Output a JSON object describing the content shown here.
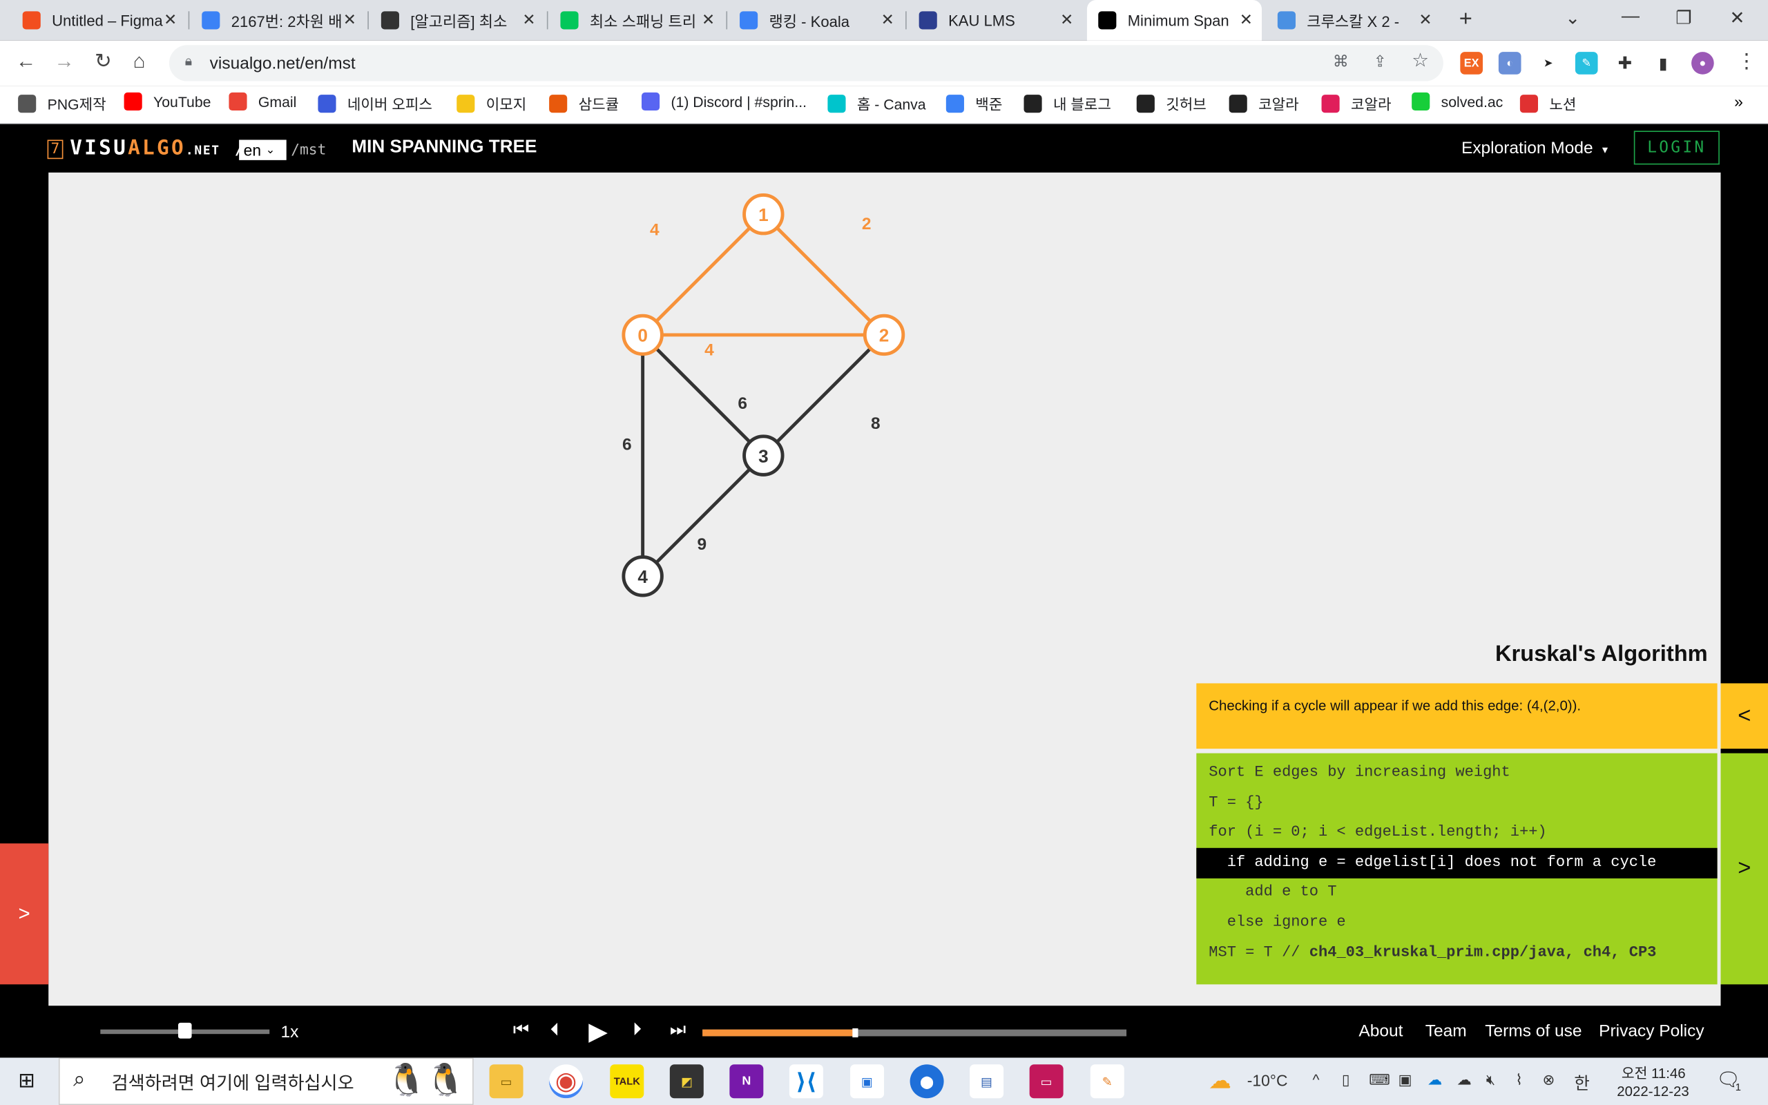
{
  "browser": {
    "tabs": [
      {
        "title": "Untitled – Figma",
        "icon": "figma-icon",
        "color": "#f24e1e"
      },
      {
        "title": "2167번: 2차원 배",
        "icon": "code-icon",
        "color": "#3b82f6"
      },
      {
        "title": "[알고리즘] 최소",
        "icon": "penguin-icon",
        "color": "#333333"
      },
      {
        "title": "최소 스패닝 트리",
        "icon": "blog-icon",
        "color": "#03c75a"
      },
      {
        "title": "랭킹 - Koala",
        "icon": "code-icon",
        "color": "#3b82f6"
      },
      {
        "title": "KAU LMS",
        "icon": "kau-icon",
        "color": "#2c3e8f"
      },
      {
        "title": "Minimum Span",
        "icon": "visualgo-icon",
        "color": "#000000"
      },
      {
        "title": "크루스칼 X 2 -",
        "icon": "layers-icon",
        "color": "#4a90e2"
      }
    ],
    "active_tab": 6,
    "url": "visualgo.net/en/mst",
    "bookmarks": [
      {
        "label": "PNG제작",
        "icon": "layers-icon",
        "color": "#555555"
      },
      {
        "label": "YouTube",
        "icon": "youtube-icon",
        "color": "#ff0000"
      },
      {
        "label": "Gmail",
        "icon": "gmail-icon",
        "color": "#ea4335"
      },
      {
        "label": "네이버 오피스",
        "icon": "grid-icon",
        "color": "#3b5bdb"
      },
      {
        "label": "이모지",
        "icon": "emoji-icon",
        "color": "#f5c518"
      },
      {
        "label": "삼드큘",
        "icon": "cube-icon",
        "color": "#e8590c"
      },
      {
        "label": "(1) Discord | #sprin...",
        "icon": "discord-icon",
        "color": "#5865f2"
      },
      {
        "label": "홈 - Canva",
        "icon": "canva-icon",
        "color": "#00c4cc"
      },
      {
        "label": "백준",
        "icon": "code-icon",
        "color": "#3b82f6"
      },
      {
        "label": "내 블로그",
        "icon": "dots-icon",
        "color": "#222222"
      },
      {
        "label": "깃허브",
        "icon": "github-icon",
        "color": "#222222"
      },
      {
        "label": "코알라",
        "icon": "dots-icon",
        "color": "#222222"
      },
      {
        "label": "코알라",
        "icon": "slack-icon",
        "color": "#e01e5a"
      },
      {
        "label": "solved.ac",
        "icon": "solved-icon",
        "color": "#17ce3a"
      },
      {
        "label": "노션",
        "icon": "party-icon",
        "color": "#e03131"
      }
    ]
  },
  "app": {
    "logo_num": "7",
    "logo_a": "VISU",
    "logo_b": "ALGO",
    "logo_c": ".NET",
    "logo_slash": "/",
    "lang": "en",
    "path": "/mst",
    "title": "MIN SPANNING TREE",
    "mode": "Exploration Mode",
    "mode_caret": "▾",
    "login": "LOGIN"
  },
  "graph": {
    "nodes": [
      {
        "id": "0",
        "highlighted": true
      },
      {
        "id": "1",
        "highlighted": true
      },
      {
        "id": "2",
        "highlighted": true
      },
      {
        "id": "3",
        "highlighted": false
      },
      {
        "id": "4",
        "highlighted": false
      }
    ],
    "edges": [
      {
        "from": "0",
        "to": "1",
        "weight": "4",
        "highlighted": true
      },
      {
        "from": "1",
        "to": "2",
        "weight": "2",
        "highlighted": true
      },
      {
        "from": "0",
        "to": "2",
        "weight": "4",
        "highlighted": true
      },
      {
        "from": "0",
        "to": "3",
        "weight": "6",
        "highlighted": false
      },
      {
        "from": "2",
        "to": "3",
        "weight": "8",
        "highlighted": false
      },
      {
        "from": "0",
        "to": "4",
        "weight": "6",
        "highlighted": false
      },
      {
        "from": "3",
        "to": "4",
        "weight": "9",
        "highlighted": false
      }
    ],
    "highlight_color": "#f7923a",
    "normal_color": "#333333"
  },
  "algo": {
    "name": "Kruskal's Algorithm",
    "status": "Checking if a cycle will appear if we add this edge: (4,(2,0)).",
    "code": [
      "Sort E edges by increasing weight",
      "T = {}",
      "for (i = 0; i < edgeList.length; i++)",
      "  if adding e = edgelist[i] does not form a cycle",
      "    add e to T",
      "  else ignore e",
      "MST = T // "
    ],
    "code_tail": "ch4_03_kruskal_prim.cpp/java, ch4, CP3",
    "highlight_line": 3,
    "status_color": "#ffc21f",
    "code_color": "#9ed21f"
  },
  "playback": {
    "speed_label": "1x",
    "speed_fraction": 0.5,
    "progress_fraction": 0.36,
    "open_panel": ">",
    "collapse": "<",
    "expand": ">"
  },
  "footer": {
    "links": [
      "About",
      "Team",
      "Terms of use",
      "Privacy Policy"
    ]
  },
  "taskbar": {
    "search_placeholder": "검색하려면 여기에 입력하십시오",
    "weather": "-10°C",
    "ime": "한",
    "time_ampm": "오전 11:46",
    "date": "2022-12-23",
    "notif_count": "1"
  }
}
